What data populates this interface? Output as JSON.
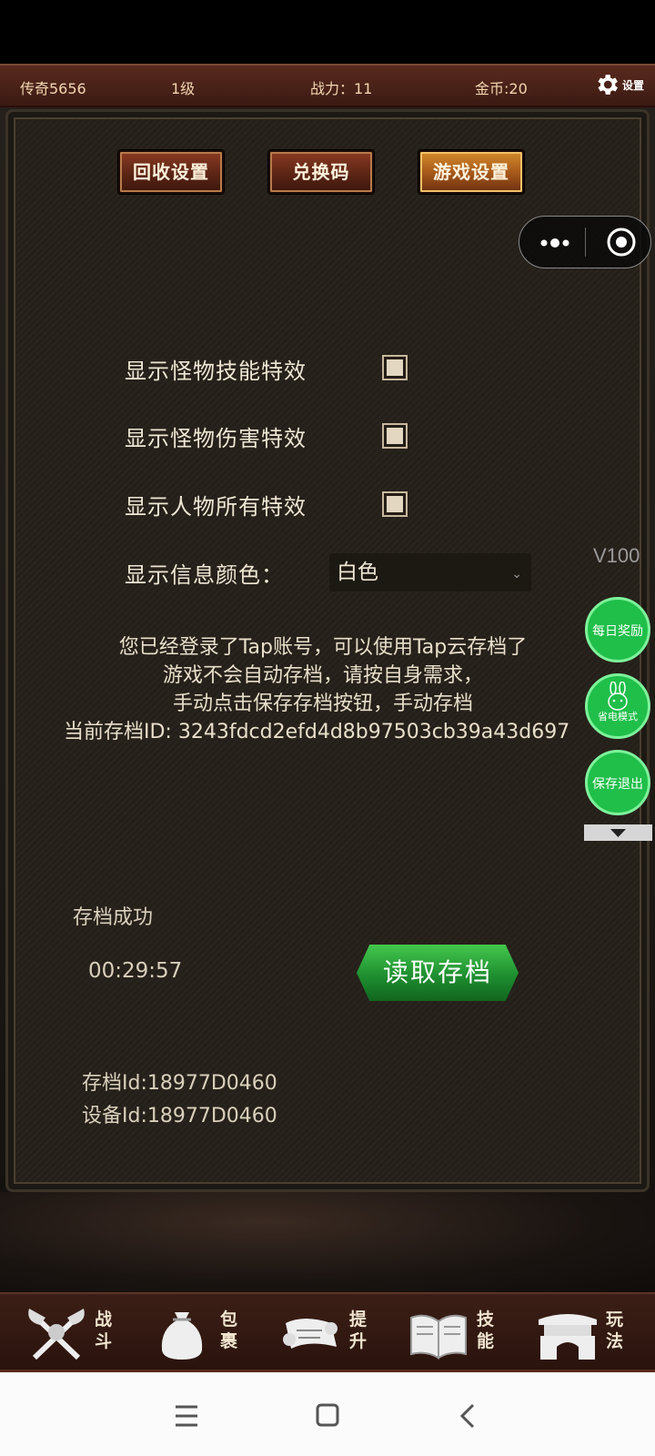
{
  "top_bar": {
    "player_name": "传奇5656",
    "level": "1级",
    "power": "战力：11",
    "gold": "金币:20",
    "settings_label": "设置"
  },
  "tabs": [
    {
      "label": "回收设置",
      "active": false
    },
    {
      "label": "兑换码",
      "active": false
    },
    {
      "label": "游戏设置",
      "active": true
    }
  ],
  "options": [
    {
      "label": "显示怪物技能特效",
      "checked": false
    },
    {
      "label": "显示怪物伤害特效",
      "checked": false
    },
    {
      "label": "显示人物所有特效",
      "checked": false
    }
  ],
  "info_color": {
    "label": "显示信息颜色：",
    "value": "白色"
  },
  "version": "V100",
  "cloud_info": [
    "您已经登录了Tap账号，可以使用Tap云存档了",
    "游戏不会自动存档，请按自身需求，",
    "手动点击保存存档按钮，手动存档",
    "当前存档ID: 3243fdcd2efd4d8b97503cb39a43d697"
  ],
  "floating": {
    "daily": "每日奖励",
    "power_save": "省电模式",
    "save_exit": "保存退出"
  },
  "save": {
    "status": "存档成功",
    "time": "00:29:57",
    "load_button": "读取存档"
  },
  "ids": {
    "save_id": "存档Id:18977D0460",
    "device_id": "设备Id:18977D0460"
  },
  "nav": [
    {
      "label": "战斗",
      "icon": "battle-axes-icon"
    },
    {
      "label": "包裹",
      "icon": "bag-icon"
    },
    {
      "label": "提升",
      "icon": "scroll-icon"
    },
    {
      "label": "技能",
      "icon": "book-icon"
    },
    {
      "label": "玩法",
      "icon": "gate-icon"
    }
  ],
  "colors": {
    "accent_green": "#1fbf4a",
    "tab_active": "#d38a2a",
    "bar_red": "#5a2a1e"
  }
}
